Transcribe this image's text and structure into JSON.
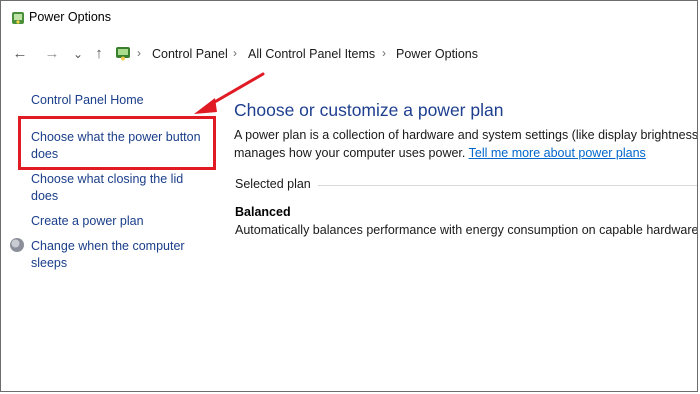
{
  "window": {
    "title": "Power Options"
  },
  "nav": {
    "back_label": "←",
    "forward_label": "→",
    "recent_label": "⌄",
    "up_label": "↑"
  },
  "breadcrumb": {
    "items": [
      "Control Panel",
      "All Control Panel Items",
      "Power Options"
    ],
    "separator": "›"
  },
  "sidebar": {
    "home": "Control Panel Home",
    "items": [
      {
        "line1": "Choose what the power button",
        "line2": "does"
      },
      {
        "line1": "Choose what closing the lid",
        "line2": "does"
      },
      {
        "line1": "Create a power plan",
        "line2": ""
      },
      {
        "line1": "Change when the computer",
        "line2": "sleeps"
      }
    ]
  },
  "main": {
    "title": "Choose or customize a power plan",
    "desc_line1": "A power plan is a collection of hardware and system settings (like display brightness,",
    "desc_line2_prefix": "manages how your computer uses power. ",
    "desc_link": "Tell me more about power plans",
    "group_label": "Selected plan",
    "plan_name": "Balanced",
    "plan_desc": "Automatically balances performance with energy consumption on capable hardware."
  },
  "colors": {
    "annotation": "#e01b24",
    "link": "#1a3e8a",
    "title": "#1e3f8f"
  },
  "icons": [
    "power-options-icon",
    "back-arrow-icon",
    "forward-arrow-icon",
    "chevron-down-icon",
    "up-arrow-icon",
    "control-panel-icon",
    "chevron-right-icon",
    "shield-icon"
  ]
}
